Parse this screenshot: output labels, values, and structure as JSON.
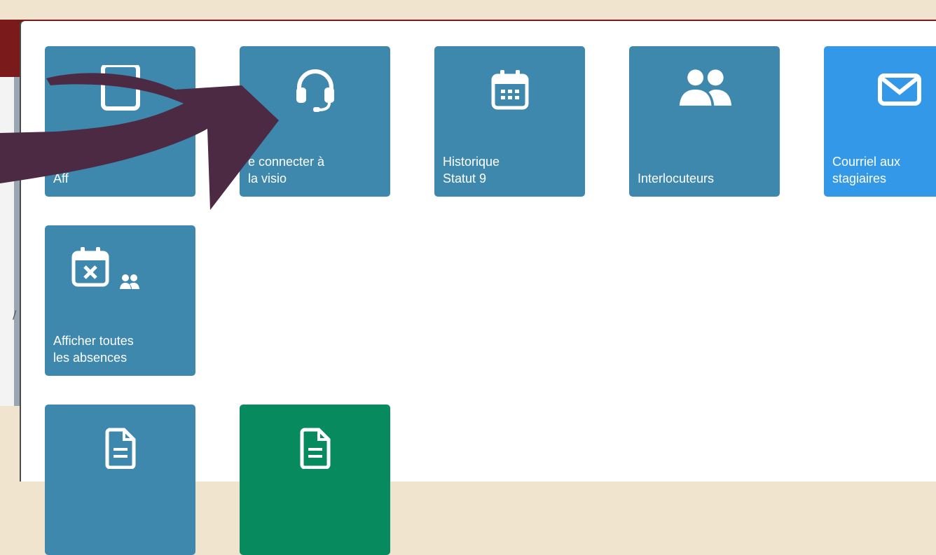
{
  "background": {
    "chars": [
      "a",
      "/"
    ]
  },
  "tiles": [
    {
      "label_line1": "Aff",
      "label_line2": "",
      "icon": "tablet-icon"
    },
    {
      "label_line1": "e connecter à",
      "label_line2": "la visio",
      "icon": "headset-icon"
    },
    {
      "label_line1": "Historique",
      "label_line2": "Statut 9",
      "icon": "calendar-icon"
    },
    {
      "label_line1": "",
      "label_line2": "Interlocuteurs",
      "icon": "users-icon"
    },
    {
      "label_line1": "Courriel aux",
      "label_line2": "stagiaires",
      "icon": "envelope-icon"
    },
    {
      "label_line1": "Afficher toutes",
      "label_line2": "les absences",
      "icon": "calendar-x-users-icon"
    },
    {
      "label_line1": "",
      "label_line2": "",
      "icon": "document-icon"
    },
    {
      "label_line1": "",
      "label_line2": "",
      "icon": "document-icon"
    }
  ],
  "colors": {
    "tile_default": "#3e88ae",
    "tile_light": "#3498e8",
    "tile_green": "#088a5f",
    "arrow": "#4c2a43",
    "page_background": "#f1e4cf",
    "header_band": "#7b1a1a"
  }
}
